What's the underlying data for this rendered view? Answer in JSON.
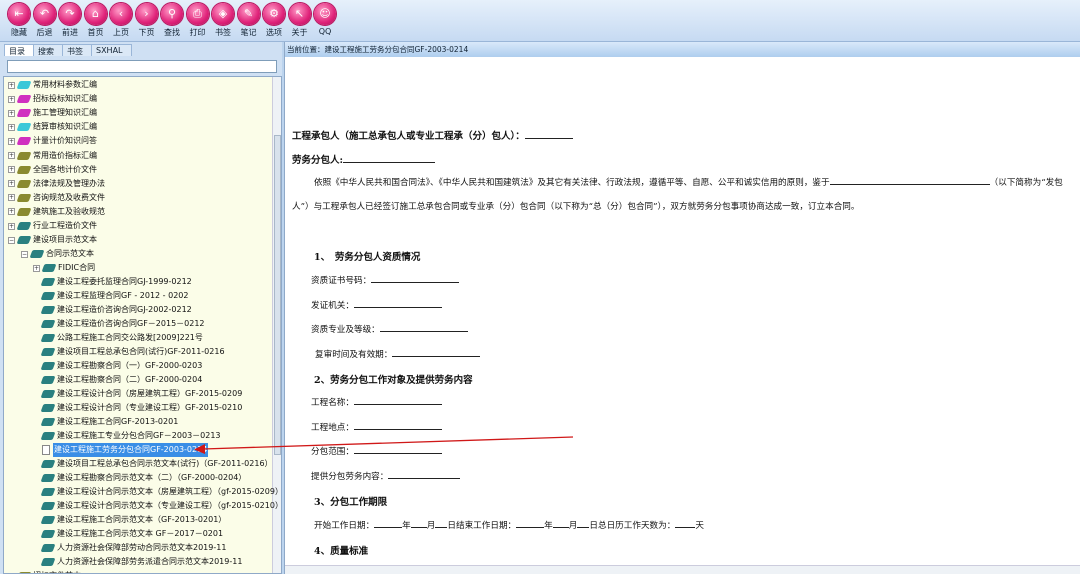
{
  "toolbar": [
    {
      "label": "隐藏",
      "icon": "hide-icon",
      "g": "⇤"
    },
    {
      "label": "后退",
      "icon": "back-icon",
      "g": "↶"
    },
    {
      "label": "前进",
      "icon": "forward-icon",
      "g": "↷"
    },
    {
      "label": "首页",
      "icon": "home-icon",
      "g": "⌂"
    },
    {
      "label": "上页",
      "icon": "prev-page-icon",
      "g": "‹"
    },
    {
      "label": "下页",
      "icon": "next-page-icon",
      "g": "›"
    },
    {
      "label": "查找",
      "icon": "find-icon",
      "g": "⚲"
    },
    {
      "label": "打印",
      "icon": "print-icon",
      "g": "⎙"
    },
    {
      "label": "书签",
      "icon": "bookmark-icon",
      "g": "◈"
    },
    {
      "label": "笔记",
      "icon": "note-icon",
      "g": "✎"
    },
    {
      "label": "选项",
      "icon": "options-icon",
      "g": "⚙"
    },
    {
      "label": "关于",
      "icon": "about-icon",
      "g": "↖"
    },
    {
      "label": "QQ",
      "icon": "qq-icon",
      "g": "☺"
    }
  ],
  "left_tabs": [
    "目录",
    "搜索",
    "书签",
    "SXHAL"
  ],
  "search": {
    "value": ""
  },
  "tree_top": [
    {
      "label": "常用材料参数汇编",
      "color": "#3cc8d8"
    },
    {
      "label": "招标投标知识汇编",
      "color": "#d030c0"
    },
    {
      "label": "施工管理知识汇编",
      "color": "#d030c0"
    },
    {
      "label": "结算审核知识汇编",
      "color": "#3cc8d8"
    },
    {
      "label": "计量计价知识问答",
      "color": "#d030c0"
    },
    {
      "label": "常用造价指标汇编",
      "color": "#8a8a30"
    },
    {
      "label": "全国各地计价文件",
      "color": "#8a8a30"
    },
    {
      "label": "法律法规及管理办法",
      "color": "#8a8a30"
    },
    {
      "label": "咨询规范及收费文件",
      "color": "#8a8a30"
    },
    {
      "label": "建筑施工及验收规范",
      "color": "#8a8a30"
    },
    {
      "label": "行业工程造价文件",
      "color": "#2a8080"
    },
    {
      "label": "建设项目示范文本",
      "color": "#2a8080"
    }
  ],
  "tree_sub": "合同示范文本",
  "tree_fidic": "FIDIC合同",
  "tree_items": [
    "建设工程委托监理合同GJ-1999-0212",
    "建设工程监理合同GF - 2012 - 0202",
    "建设工程造价咨询合同GJ-2002-0212",
    "建设工程造价咨询合同GF－2015－0212",
    "公路工程施工合同交公路发[2009]221号",
    "建设项目工程总承包合同(试行)GF-2011-0216",
    "建设工程勘察合同（一）GF-2000-0203",
    "建设工程勘察合同（二）GF-2000-0204",
    "建设工程设计合同（房屋建筑工程）GF-2015-0209",
    "建设工程设计合同（专业建设工程）GF-2015-0210",
    "建设工程施工合同GF-2013-0201",
    "建设工程施工专业分包合同GF－2003－0213",
    "建设工程施工劳务分包合同GF-2003-0214",
    "建设项目工程总承包合同示范文本(试行)（GF-2011-0216）",
    "建设工程勘察合同示范文本（二）（GF-2000-0204）",
    "建设工程设计合同示范文本（房屋建筑工程）（gf-2015-0209）",
    "建设工程设计合同示范文本（专业建设工程）（gf-2015-0210）",
    "建设工程施工合同示范文本（GF-2013-0201）",
    "建设工程施工合同示范文本 GF－2017－0201",
    "人力资源社会保障部劳动合同示范文本2019-11",
    "人力资源社会保障部劳务派遣合同示范文本2019-11"
  ],
  "selected_index": 12,
  "tree_last": "招标文件范本",
  "breadcrumb": "当前位置：建设工程施工劳务分包合同GF-2003-0214",
  "doc": {
    "l1": "工程承包人（施工总承包人或专业工程承（分）包人）：",
    "l2": "劳务分包人:",
    "p1a": "依照《中华人民共和国合同法》、《中华人民共和国建筑法》及其它有关法律、行政法规，遵循平等、自愿、公平和诚实信用的原则，鉴于",
    "p1b": "（以下简称为“发包",
    "p2": "人”）与工程承包人已经签订施工总承包合同或专业承（分）包合同（以下称为“总（分）包合同”），双方就劳务分包事项协商达成一致，订立本合同。",
    "s1": "1、　劳务分包人资质情况",
    "f1": [
      "资质证书号码：",
      "发证机关：",
      "资质专业及等级：",
      "复审时间及有效期："
    ],
    "s2": "2、劳务分包工作对象及提供劳务内容",
    "f2": [
      "工程名称：",
      "工程地点：",
      "分包范围：",
      "提供分包劳务内容："
    ],
    "s3": "3、分包工作期限",
    "d": [
      "开始工作日期：",
      "年",
      "月",
      "日结束工作日期：",
      "年",
      "月",
      "日总日历工作天数为：",
      "天"
    ],
    "s4": "4、质量标准"
  },
  "annotation_color": "#d01818"
}
